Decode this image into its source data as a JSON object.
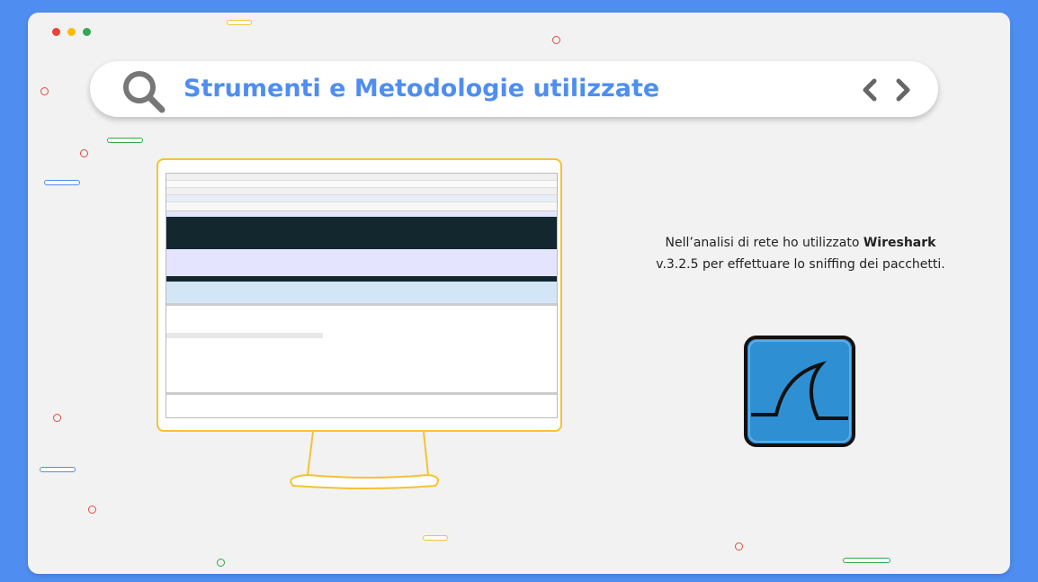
{
  "header": {
    "title": "Strumenti e Metodologie utilizzate"
  },
  "window_dots": [
    "#ea4335",
    "#fbbc05",
    "#34a853"
  ],
  "description": {
    "prefix": "Nell’analisi di rete ho utilizzato ",
    "tool": "Wireshark",
    "suffix": "v.3.2.5 per effettuare lo sniffing dei pacchetti."
  },
  "icons": {
    "search": "search-icon",
    "prev": "chevron-left-icon",
    "next": "chevron-right-icon",
    "logo": "wireshark-logo-icon"
  },
  "colors": {
    "accent": "#4f8ef0",
    "monitor_border": "#f5c233",
    "logo_blue": "#2f8fd3"
  }
}
